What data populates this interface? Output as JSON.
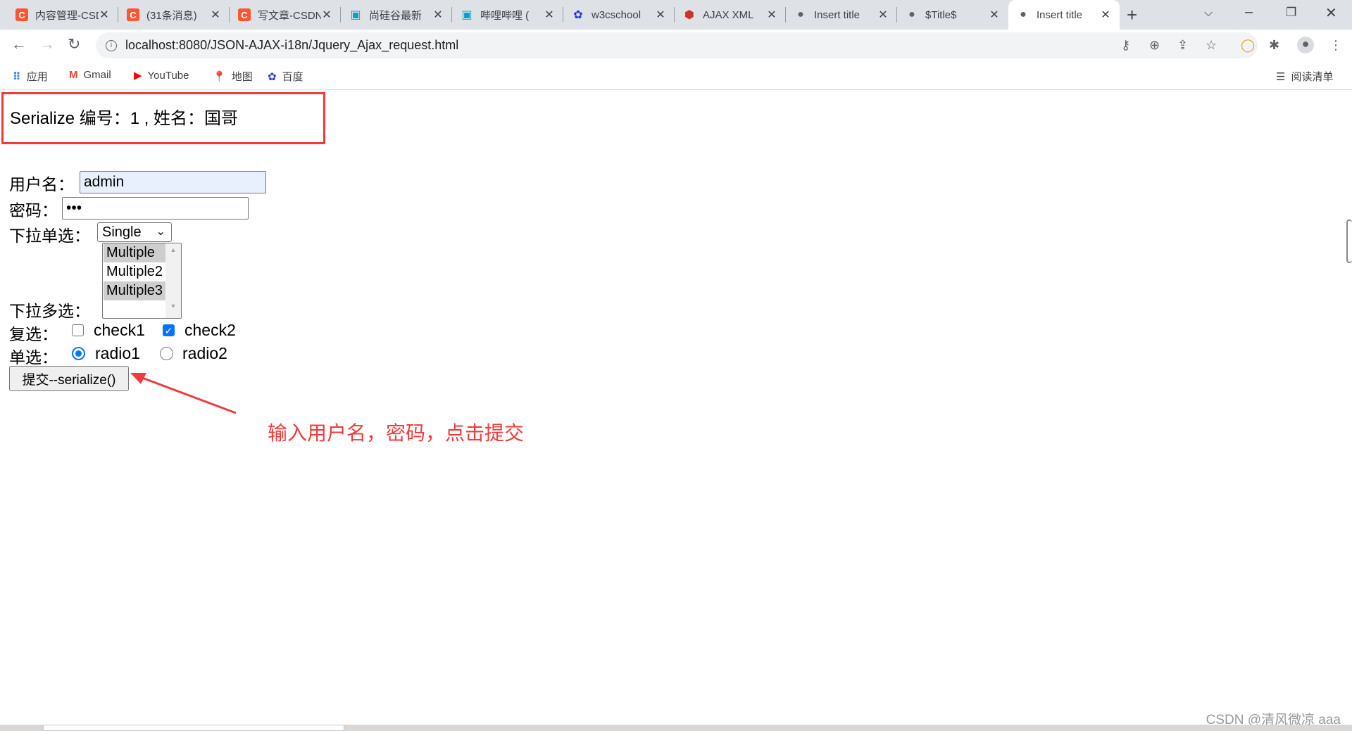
{
  "tabs": [
    {
      "title": "内容管理-CSDN",
      "icon": "csdn-icon",
      "color": "#fc5531"
    },
    {
      "title": "(31条消息)",
      "icon": "csdn-icon",
      "color": "#fc5531"
    },
    {
      "title": "写文章-CSDN",
      "icon": "csdn-icon",
      "color": "#fc5531"
    },
    {
      "title": "尚硅谷最新",
      "icon": "bilibili-icon",
      "color": "#00a1d6"
    },
    {
      "title": "哔哩哔哩 (",
      "icon": "bilibili-icon",
      "color": "#00a1d6"
    },
    {
      "title": "w3cschool",
      "icon": "baidu-paw-icon",
      "color": "#2932e1"
    },
    {
      "title": "AJAX XML",
      "icon": "w3c-icon",
      "color": "#d0312d"
    },
    {
      "title": "Insert title",
      "icon": "globe-icon",
      "color": "#5f6368"
    },
    {
      "title": "$Title$",
      "icon": "globe-icon",
      "color": "#5f6368"
    },
    {
      "title": "Insert title",
      "icon": "globe-icon",
      "color": "#5f6368",
      "active": true
    }
  ],
  "address": {
    "url": "localhost:8080/JSON-AJAX-i18n/Jquery_Ajax_request.html"
  },
  "bookmarks": [
    {
      "label": "应用",
      "icon": "apps-icon"
    },
    {
      "label": "Gmail",
      "icon": "gmail-icon"
    },
    {
      "label": "YouTube",
      "icon": "youtube-icon"
    },
    {
      "label": "地图",
      "icon": "maps-icon"
    },
    {
      "label": "百度",
      "icon": "baidu-icon"
    }
  ],
  "reading_list": "阅读清单",
  "result": "Serialize 编号：1 , 姓名：国哥",
  "form": {
    "username_label": "用户名：",
    "username_value": "admin",
    "password_label": "密码：",
    "password_value": "abc",
    "single_label": "下拉单选：",
    "single_value": "Single",
    "multi_label": "下拉多选：",
    "multi_options": [
      {
        "label": "Multiple",
        "selected": true
      },
      {
        "label": "Multiple2",
        "selected": false
      },
      {
        "label": "Multiple3",
        "selected": true
      }
    ],
    "check_label": "复选：",
    "check1": "check1",
    "check1_checked": false,
    "check2": "check2",
    "check2_checked": true,
    "radio_label": "单选：",
    "radio1": "radio1",
    "radio1_checked": true,
    "radio2": "radio2",
    "radio2_checked": false,
    "submit": "提交--serialize()"
  },
  "annotation": "输入用户名，密码，点击提交",
  "annotation_color": "#f2393b",
  "watermark": "CSDN @清风微凉 aaa"
}
